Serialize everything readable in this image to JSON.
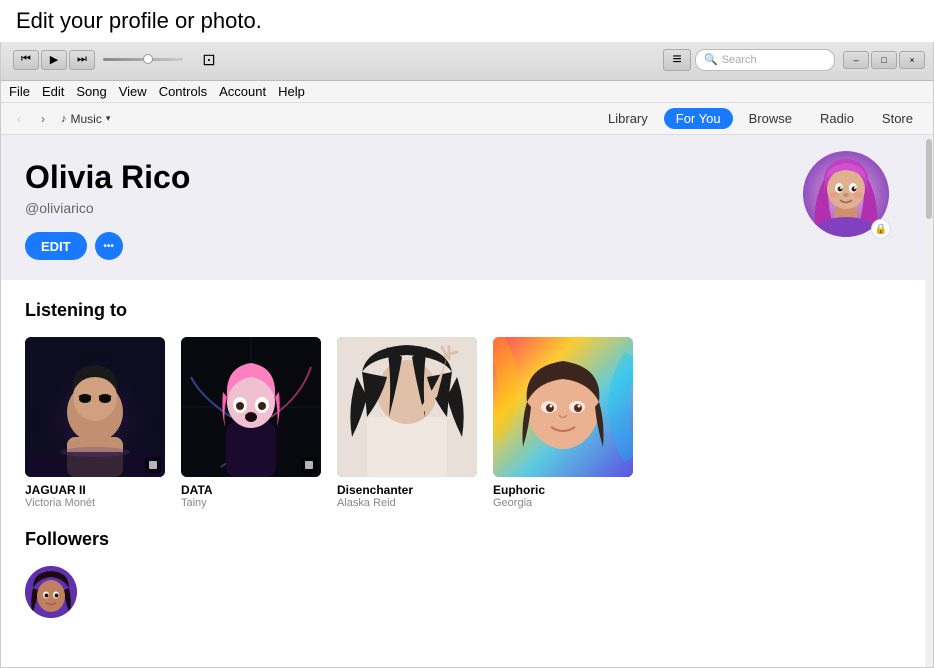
{
  "tooltip": {
    "text": "Edit your profile or photo."
  },
  "titlebar": {
    "rewind_label": "⏮",
    "play_label": "▶",
    "fastforward_label": "⏭",
    "airplay_label": "⊡",
    "apple_logo": "",
    "list_icon": "≡",
    "search_placeholder": "Search",
    "minimize_label": "–",
    "maximize_label": "□",
    "close_label": "×"
  },
  "menubar": {
    "items": [
      "File",
      "Edit",
      "Song",
      "View",
      "Controls",
      "Account",
      "Help"
    ]
  },
  "navbar": {
    "back_label": "‹",
    "forward_label": "›",
    "source_icon": "♪",
    "source_label": "Music",
    "tabs": [
      {
        "label": "Library",
        "active": false
      },
      {
        "label": "For You",
        "active": true
      },
      {
        "label": "Browse",
        "active": false
      },
      {
        "label": "Radio",
        "active": false
      },
      {
        "label": "Store",
        "active": false
      }
    ]
  },
  "profile": {
    "name": "Olivia Rico",
    "handle": "@oliviarico",
    "edit_label": "EDIT",
    "more_label": "•••",
    "lock_icon": "🔒"
  },
  "listening_section": {
    "title": "Listening to",
    "albums": [
      {
        "title": "JAGUAR II",
        "artist": "Victoria Monét",
        "has_badge": true
      },
      {
        "title": "DATA",
        "artist": "Tainy",
        "has_badge": true
      },
      {
        "title": "Disenchanter",
        "artist": "Alaska Reid",
        "has_badge": false
      },
      {
        "title": "Euphoric",
        "artist": "Georgia",
        "has_badge": false
      }
    ]
  },
  "followers_section": {
    "title": "Followers"
  }
}
